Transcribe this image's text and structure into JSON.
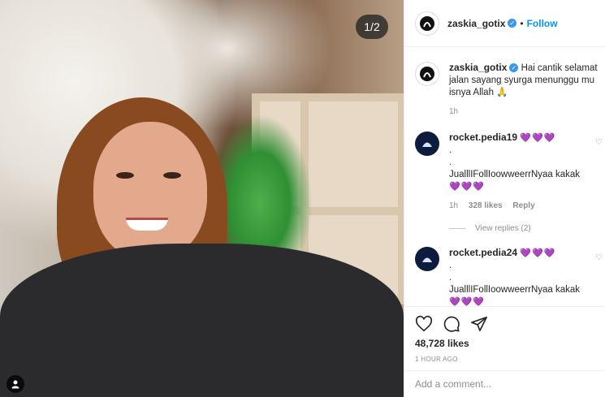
{
  "photo": {
    "counter": "1/2"
  },
  "header": {
    "username": "zaskia_gotix",
    "separator": "•",
    "follow_label": "Follow"
  },
  "caption": {
    "username": "zaskia_gotix",
    "text": "Hai cantik selamat jalan sayang syurga menunggu mu isnya Allah 🙏",
    "time": "1h"
  },
  "comments": [
    {
      "username": "rocket.pedia19",
      "hearts": "💜💜💜",
      "line2": ".",
      "line3": ".",
      "text": "JualllIFollIoowweerrNyaa kakak",
      "hearts2": "💜💜💜",
      "time": "1h",
      "likes": "328 likes",
      "reply": "Reply",
      "view_replies": "View replies (2)"
    },
    {
      "username": "rocket.pedia24",
      "hearts": "💜💜💜",
      "line2": ".",
      "line3": ".",
      "text": "JualllIFollIoowweerrNyaa kakak",
      "hearts2": "💜💜💜"
    }
  ],
  "actions": {
    "likes": "48,728 likes",
    "posted": "1 HOUR AGO"
  },
  "add_comment": {
    "placeholder": "Add a comment..."
  },
  "colors": {
    "link": "#0095f6",
    "verified": "#3897f0",
    "muted": "#8e8e8e"
  }
}
